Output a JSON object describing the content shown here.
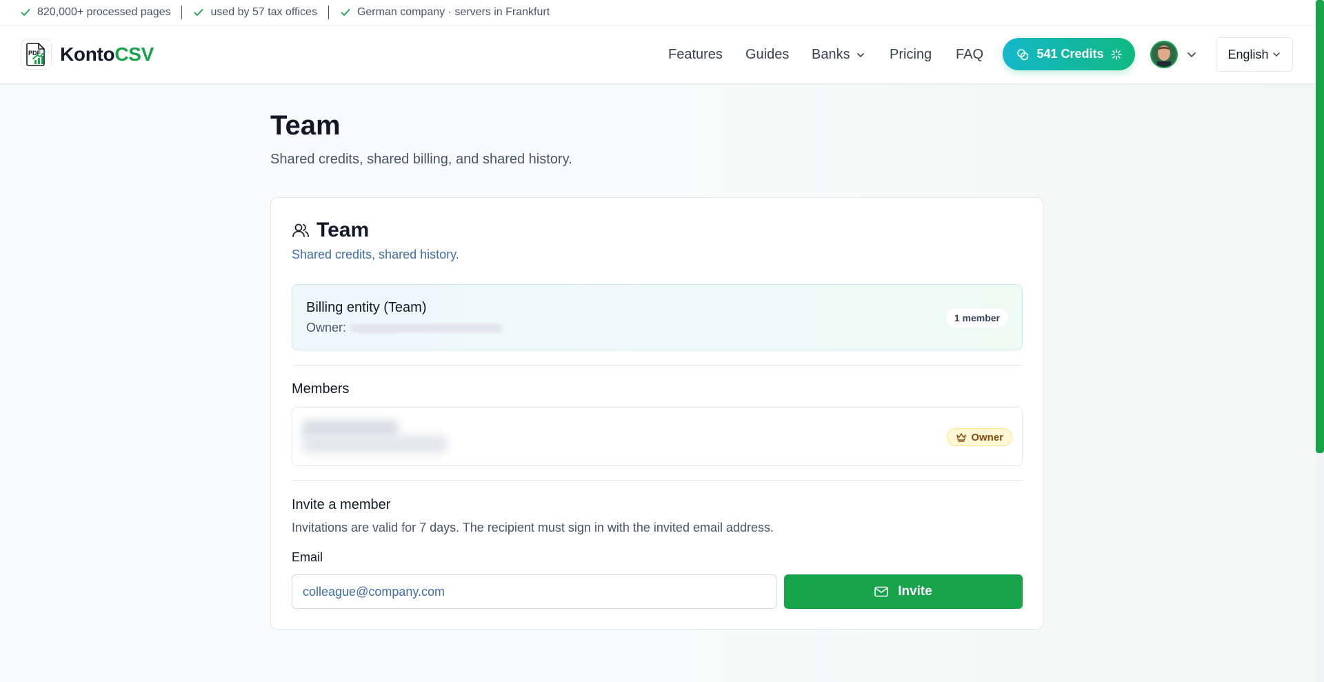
{
  "trustbar": {
    "items": [
      {
        "text": "820,000+ processed pages",
        "icon": "check-icon"
      },
      {
        "text": "used by 57 tax offices",
        "icon": "check-icon"
      },
      {
        "text": "German company · servers in Frankfurt",
        "icon": "check-icon"
      }
    ]
  },
  "header": {
    "logo_text_main": "Konto",
    "logo_text_accent": "CSV",
    "logo_icon_text": "PDF",
    "nav": {
      "features": "Features",
      "guides": "Guides",
      "banks": "Banks",
      "pricing": "Pricing",
      "faq": "FAQ"
    },
    "credits_label": "541 Credits",
    "language": "English"
  },
  "page": {
    "title": "Team",
    "subtitle": "Shared credits, shared billing, and shared history."
  },
  "card": {
    "title": "Team",
    "subtitle": "Shared credits, shared history.",
    "billing": {
      "title": "Billing entity (Team)",
      "owner_label": "Owner:",
      "member_count": "1 member"
    },
    "members_label": "Members",
    "owner_badge": "Owner",
    "invite": {
      "title": "Invite a member",
      "description": "Invitations are valid for 7 days. The recipient must sign in with the invited email address.",
      "email_label": "Email",
      "email_placeholder": "colleague@company.com",
      "button_label": "Invite"
    }
  },
  "colors": {
    "brand_green": "#16a34a",
    "credits_gradient_start": "#14b8c9",
    "credits_gradient_end": "#10b981",
    "link_blue": "#3f6ea6",
    "owner_badge_bg": "#fef7d6"
  }
}
